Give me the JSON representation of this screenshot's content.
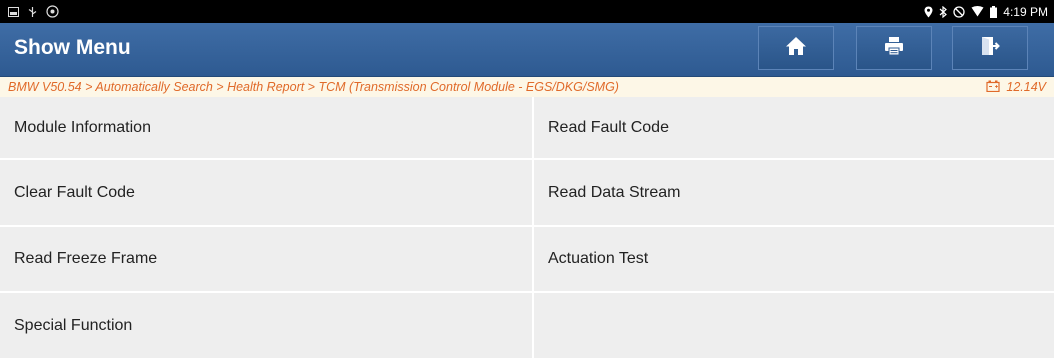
{
  "status_bar": {
    "time": "4:19 PM",
    "left_icons": [
      "gallery-icon",
      "usb-debug-icon",
      "sync-icon"
    ],
    "right_icons": [
      "location-icon",
      "bluetooth-icon",
      "do-not-disturb-icon",
      "wifi-icon",
      "battery-icon"
    ]
  },
  "header": {
    "title": "Show Menu",
    "buttons": [
      "home-icon",
      "print-icon",
      "exit-icon"
    ]
  },
  "breadcrumb": {
    "path": "BMW V50.54 > Automatically Search > Health Report > TCM (Transmission Control Module - EGS/DKG/SMG)",
    "voltage": "12.14V"
  },
  "menu": {
    "items": [
      "Module Information",
      "Read Fault Code",
      "Clear Fault Code",
      "Read Data Stream",
      "Read Freeze Frame",
      "Actuation Test",
      "Special Function"
    ]
  },
  "colors": {
    "header_bg": "#3465a0",
    "breadcrumb_text": "#e06a2a",
    "breadcrumb_bg": "#fdf7e7",
    "cell_bg": "#eeeeee"
  }
}
